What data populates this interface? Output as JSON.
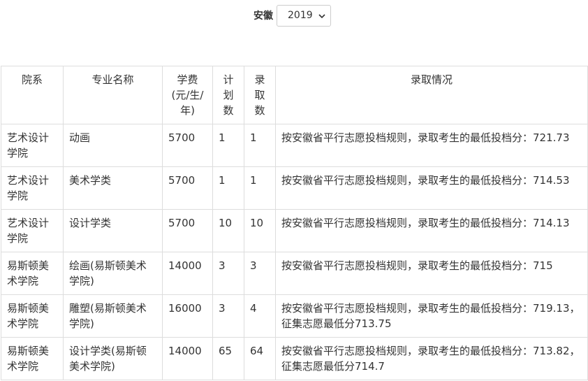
{
  "filter": {
    "province_label": "安徽",
    "year_selected": "2019"
  },
  "table": {
    "headers": [
      "院系",
      "专业名称",
      "学费(元/生/年)",
      "计划数",
      "录取数",
      "录取情况"
    ],
    "rows": [
      {
        "dept": "艺术设计学院",
        "major": "动画",
        "fee": "5700",
        "plan": "1",
        "admitted": "1",
        "status": "按安徽省平行志愿投档规则，录取考生的最低投档分：721.73"
      },
      {
        "dept": "艺术设计学院",
        "major": "美术学类",
        "fee": "5700",
        "plan": "1",
        "admitted": "1",
        "status": "按安徽省平行志愿投档规则，录取考生的最低投档分：714.53"
      },
      {
        "dept": "艺术设计学院",
        "major": "设计学类",
        "fee": "5700",
        "plan": "10",
        "admitted": "10",
        "status": "按安徽省平行志愿投档规则，录取考生的最低投档分：714.13"
      },
      {
        "dept": "易斯顿美术学院",
        "major": "绘画(易斯顿美术学院)",
        "fee": "14000",
        "plan": "3",
        "admitted": "3",
        "status": "按安徽省平行志愿投档规则，录取考生的最低投档分：715"
      },
      {
        "dept": "易斯顿美术学院",
        "major": "雕塑(易斯顿美术学院)",
        "fee": "16000",
        "plan": "3",
        "admitted": "4",
        "status": "按安徽省平行志愿投档规则，录取考生的最低投档分：719.13，征集志愿最低分713.75"
      },
      {
        "dept": "易斯顿美术学院",
        "major": "设计学类(易斯顿美术学院)",
        "fee": "14000",
        "plan": "65",
        "admitted": "64",
        "status": "按安徽省平行志愿投档规则，录取考生的最低投档分：713.82，征集志愿最低分714.7"
      }
    ]
  }
}
